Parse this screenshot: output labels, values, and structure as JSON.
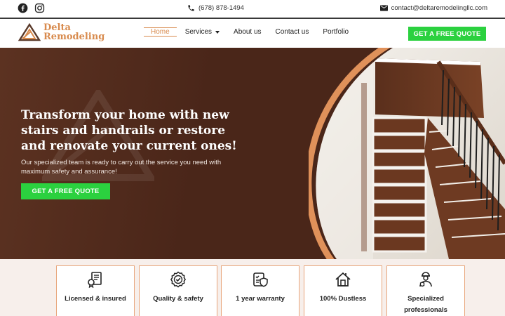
{
  "topbar": {
    "social": [
      "facebook-icon",
      "instagram-icon"
    ],
    "phone": "(678) 878-1494",
    "email": "contact@deltaremodelingllc.com"
  },
  "logo": {
    "line1": "Delta",
    "line2": "Remodeling"
  },
  "nav": {
    "items": [
      {
        "label": "Home",
        "active": true
      },
      {
        "label": "Services",
        "dropdown": true
      },
      {
        "label": "About us"
      },
      {
        "label": "Contact us"
      },
      {
        "label": "Portfolio"
      }
    ],
    "cta": "GET A FREE QUOTE"
  },
  "hero": {
    "title": "Transform your home with new stairs and handrails or restore and renovate your current ones!",
    "subtitle": "Our specialized team is ready to carry out the service you need with maximum safety and assurance!",
    "cta": "GET A FREE QUOTE"
  },
  "features": [
    {
      "icon": "document-license-icon",
      "label": "Licensed & insured"
    },
    {
      "icon": "quality-badge-icon",
      "label": "Quality & safety"
    },
    {
      "icon": "warranty-shield-icon",
      "label": "1 year warranty"
    },
    {
      "icon": "dustless-house-icon",
      "label": "100% Dustless"
    },
    {
      "icon": "professional-worker-icon",
      "label": "Specialized professionals"
    }
  ],
  "colors": {
    "accent": "#d88b4e",
    "cta": "#2bd13f",
    "hero_bg": "#4a2619"
  }
}
